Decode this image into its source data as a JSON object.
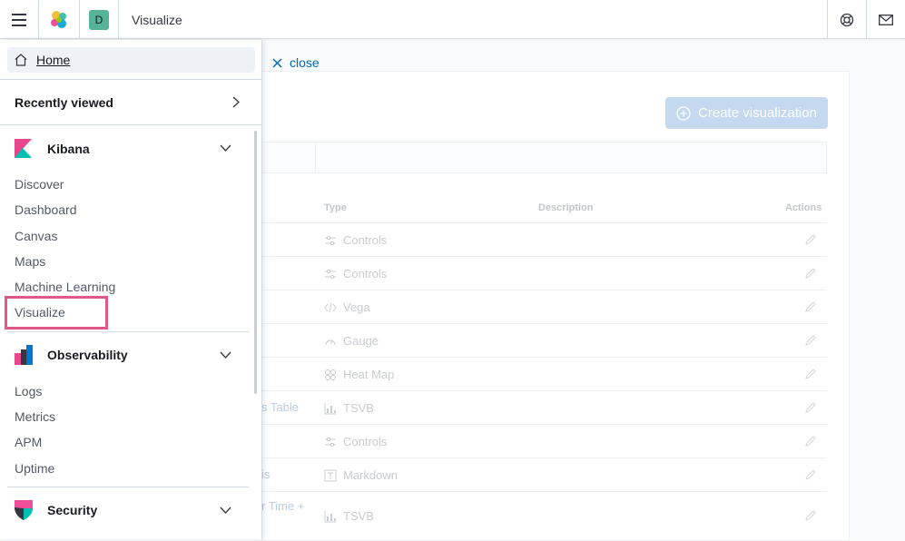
{
  "header": {
    "menu_icon": "hamburger-icon",
    "logo_icon": "elastic-logo-icon",
    "space_avatar": "D",
    "title": "Visualize",
    "help_icon": "help-lifebuoy-icon",
    "mail_icon": "mail-icon"
  },
  "background": {
    "close_label": "close",
    "create_button": "Create visualization",
    "columns": {
      "type": "Type",
      "description": "Description",
      "actions": "Actions"
    },
    "rows": [
      {
        "title": "",
        "type": "Controls",
        "icon": "controls-icon"
      },
      {
        "title": "",
        "type": "Controls",
        "icon": "controls-icon"
      },
      {
        "title": "",
        "type": "Vega",
        "icon": "code-icon"
      },
      {
        "title": "",
        "type": "Gauge",
        "icon": "gauge-icon"
      },
      {
        "title": "",
        "type": "Heat Map",
        "icon": "heatmap-icon"
      },
      {
        "title": "s Table",
        "type": "TSVB",
        "icon": "tsvb-icon"
      },
      {
        "title": "",
        "type": "Controls",
        "icon": "controls-icon"
      },
      {
        "title": "is",
        "type": "Markdown",
        "icon": "markdown-icon"
      },
      {
        "title": "r Time +",
        "type": "TSVB",
        "icon": "tsvb-icon"
      }
    ]
  },
  "nav": {
    "home": "Home",
    "recently_viewed": "Recently viewed",
    "groups": [
      {
        "name": "Kibana",
        "links": [
          "Discover",
          "Dashboard",
          "Canvas",
          "Maps",
          "Machine Learning",
          "Visualize"
        ]
      },
      {
        "name": "Observability",
        "links": [
          "Logs",
          "Metrics",
          "APM",
          "Uptime"
        ]
      },
      {
        "name": "Security",
        "links": []
      }
    ]
  },
  "colors": {
    "accent": "#006bb4",
    "highlight": "#e0578a",
    "avatar": "#54b399"
  }
}
